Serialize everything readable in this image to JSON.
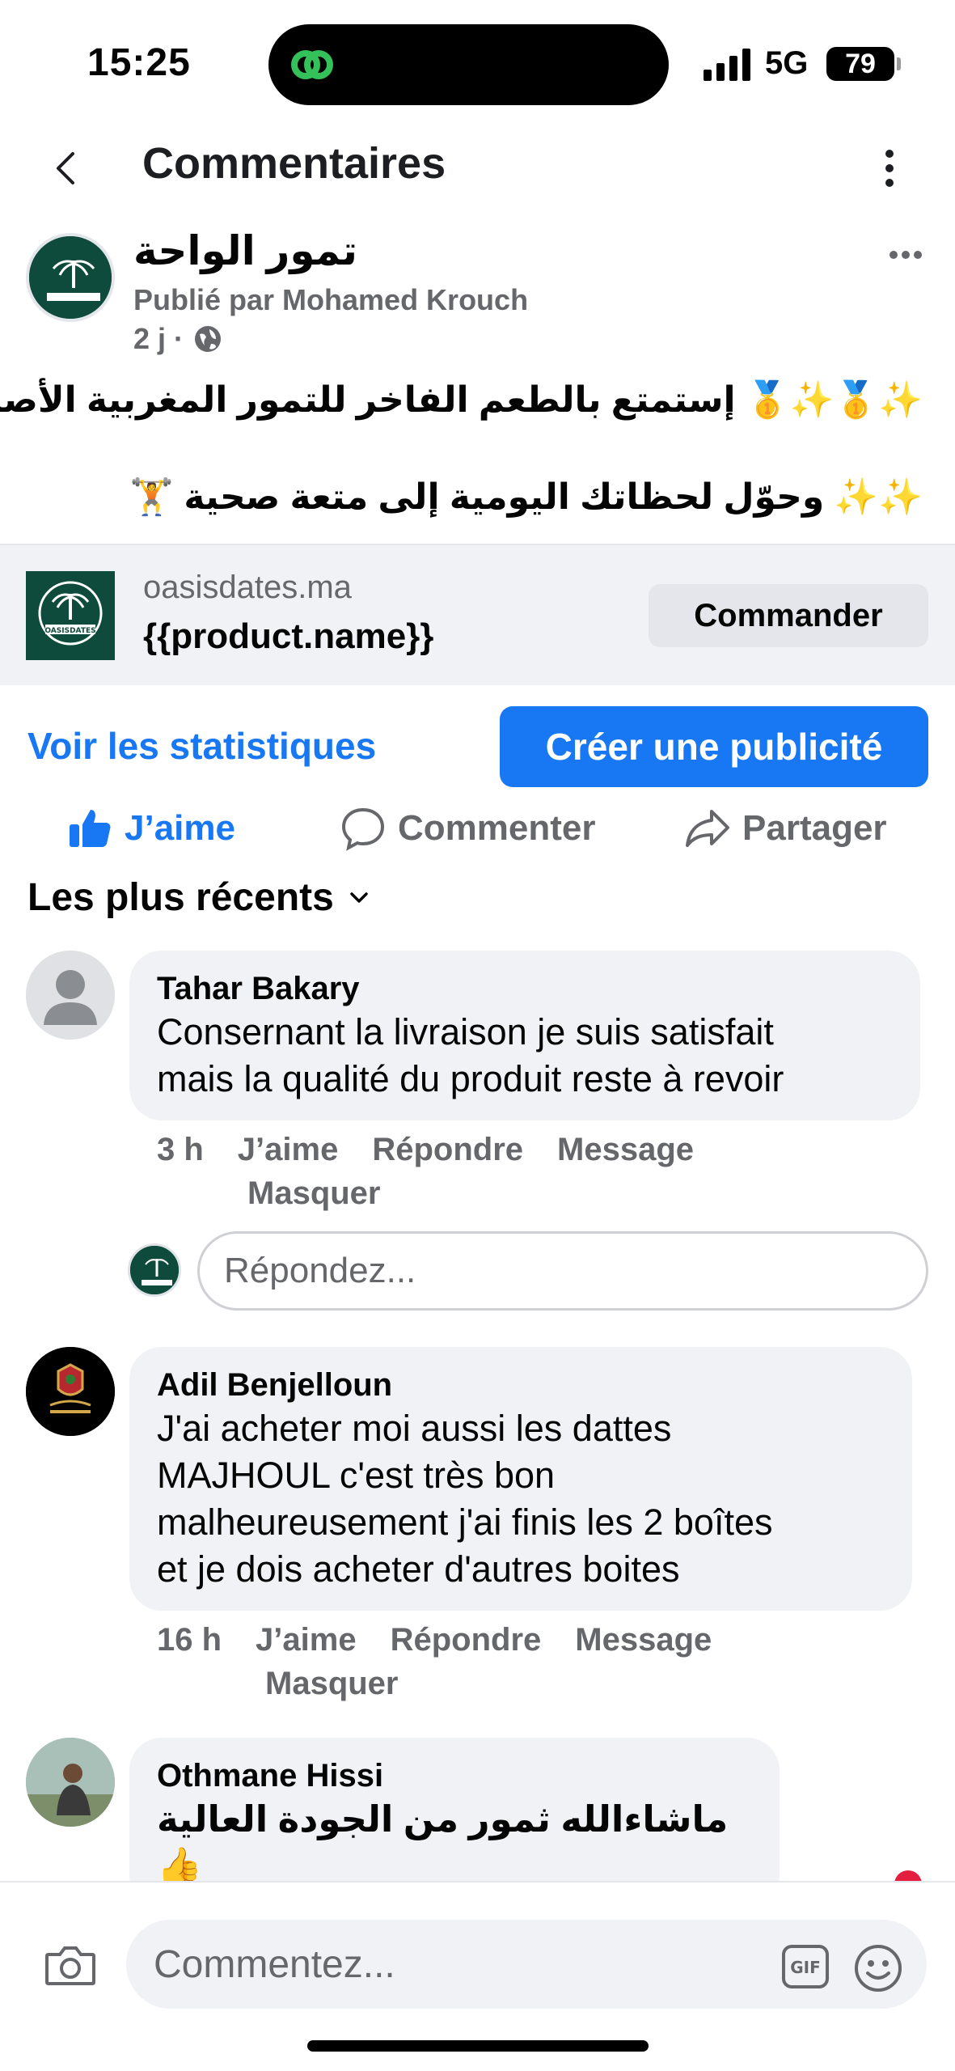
{
  "status_bar": {
    "time": "15:25",
    "network": "5G",
    "battery": "79"
  },
  "header": {
    "title": "Commentaires"
  },
  "post": {
    "page_name": "تمور الواحة",
    "published_by": "Publié par Mohamed Krouch",
    "age": "2 j ·",
    "line1": "إستمتع بالطعم الفاخر للتمور المغربية الأصيلة",
    "line2": "وحوّل لحظاتك اليومية إلى متعة صحية",
    "line1_emoji": "✨🥇✨🥇",
    "line2_emoji": "✨✨",
    "line2_trailing_emoji": "🏋️"
  },
  "link_preview": {
    "domain": "oasisdates.ma",
    "title": "{{product.name}}",
    "button": "Commander",
    "logo_text": "OASISDATES"
  },
  "actions": {
    "stats": "Voir les statistiques",
    "create_ad": "Créer une publicité",
    "like": "J’aime",
    "comment": "Commenter",
    "share": "Partager",
    "sort": "Les plus récents"
  },
  "comments": [
    {
      "author": "Tahar Bakary",
      "text_line1": "Consernant la livraison je suis satisfait",
      "text_line2": "mais la qualité du produit reste à revoir",
      "time": "3 h",
      "like": "J’aime",
      "reply": "Répondre",
      "message": "Message",
      "hide": "Masquer"
    },
    {
      "author": "Adil Benjelloun",
      "text_line1": "J'ai acheter moi aussi les dattes",
      "text_line2": "MAJHOUL c'est très bon",
      "text_line3": "malheureusement j'ai finis les 2 boîtes",
      "text_line4": "et je dois acheter d'autres boites",
      "time": "16 h",
      "like": "J’aime",
      "reply": "Répondre",
      "message": "Message",
      "hide": "Masquer"
    },
    {
      "author": "Othmane Hissi",
      "text": "ماشاءالله ثمور من الجودة العالية 👍"
    }
  ],
  "reply_box": {
    "placeholder": "Répondez..."
  },
  "composer": {
    "placeholder": "Commentez...",
    "gif": "GIF"
  },
  "colors": {
    "brand_blue": "#1877f2",
    "bubble_grey": "#f0f2f5",
    "logo_green": "#0f4b3c"
  }
}
